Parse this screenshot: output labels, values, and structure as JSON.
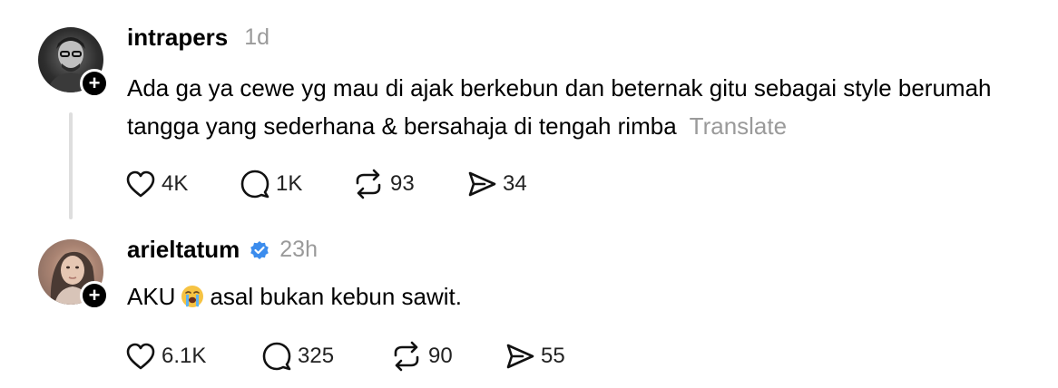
{
  "posts": [
    {
      "username": "intrapers",
      "time": "1d",
      "text": "Ada ga ya cewe yg mau di ajak berkebun dan beternak gitu sebagai style berumah tangga yang sederhana & bersahaja di tengah rimba",
      "translate_label": "Translate",
      "verified": false,
      "follow_badge": "+",
      "stats": {
        "likes": "4K",
        "replies": "1K",
        "reposts": "93",
        "shares": "34"
      }
    },
    {
      "username": "arieltatum",
      "time": "23h",
      "text_before_emoji": "AKU",
      "emoji": "loudly-crying-face-emoji",
      "text_after_emoji": "asal bukan kebun sawit.",
      "verified": true,
      "follow_badge": "+",
      "stats": {
        "likes": "6.1K",
        "replies": "325",
        "reposts": "90",
        "shares": "55"
      }
    }
  ],
  "colors": {
    "text": "#000000",
    "muted": "#9a9a9a",
    "verified_blue": "#3b8ced",
    "thread_line": "#dedede"
  },
  "icons": [
    "heart-icon",
    "comment-icon",
    "repost-icon",
    "share-icon",
    "plus-icon",
    "verified-icon"
  ]
}
